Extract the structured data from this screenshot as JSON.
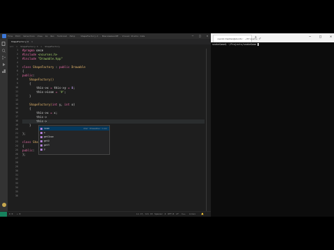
{
  "ide": {
    "title": "ShapeFactory.h - EmacsGamesCPP - Visual Studio Code",
    "menu": [
      "File",
      "Edit",
      "Selection",
      "View",
      "Go",
      "Run",
      "Terminal",
      "Help"
    ],
    "window_controls": [
      "–",
      "□",
      "✕"
    ],
    "tab": {
      "label": "ShapeFactory.h",
      "close": "×"
    },
    "breadcrumb": [
      "src",
      ">",
      "ShapeFactory.h",
      ">",
      "ShapeFactory"
    ],
    "line_numbers": [
      "1",
      "2",
      "3",
      "4",
      "5",
      "6",
      "7",
      "8",
      "9",
      "10",
      "11",
      "12",
      "13",
      "14",
      "15",
      "16",
      "17",
      "18",
      "19",
      "20",
      "21",
      "22",
      "23",
      "24",
      "25",
      "26",
      "27",
      "28",
      "29",
      "30",
      "31",
      "32",
      "33",
      "34",
      "35",
      "36"
    ],
    "code": {
      "l1_kw": "#pragma",
      "l1_rest": " once",
      "l2_kw": "#include",
      "l2_str": " <ncurses.h>",
      "l3_kw": "#include",
      "l3_str": " \"Drawable.hpp\"",
      "l5_kw": "class",
      "l5_ty": " ShapeFactory",
      "l5_op": " : ",
      "l5_kw2": "public",
      "l5_ty2": " Drawable",
      "l6": "{",
      "l7_kw": "public",
      "l7_rest": ":",
      "l8": "    ShapeFactory()",
      "l9": "    {",
      "l10_a": "        this->x",
      "l10_b": " = ",
      "l10_c": "this->y",
      "l10_d": " = ",
      "l10_e": "0",
      "l10_f": ";",
      "l11_a": "        this->icon",
      "l11_b": " = ",
      "l11_c": "'#'",
      "l11_d": ";",
      "l12": "    }",
      "l14_a": "    ShapeFactory(",
      "l14_ty": "int",
      "l14_b": " y, ",
      "l14_ty2": "int",
      "l14_c": " x)",
      "l15": "    {",
      "l16_a": "        this->x",
      "l16_b": " = ",
      "l16_c": "x",
      "l16_d": ";",
      "l17": "        this->",
      "l18": "        this->",
      "l19": "    }",
      "l21": "};",
      "l23_kw": "class",
      "l23_ty": " ShapeFact",
      "l24": "{",
      "l25_kw": "public",
      "l25_rest": ":",
      "l26": "};"
    },
    "suggest": {
      "items": [
        "icon",
        "x",
        "getIcon",
        "getX",
        "getY",
        "y"
      ],
      "selected_detail": "char Drawable::icon"
    },
    "status": {
      "left": [
        "⊗ 0",
        "⚠ 0"
      ],
      "right": [
        "Ln 17, Col 15",
        "Spaces: 4",
        "UTF-8",
        "LF",
        "C++",
        "Linux",
        "🔔"
      ]
    }
  },
  "terminal": {
    "tab_label": "casimirmadden@ubuntu: ~/Projects",
    "tab_close": "×",
    "add": "+",
    "dropdown": "⌄",
    "controls": [
      "–",
      "□",
      "✕"
    ],
    "prompt": "snakeGame$ ~/Projects/snakeGame"
  },
  "colors": {
    "editor_bg": "#1e1e1e",
    "keyword": "#e86ca8",
    "string": "#a5d46a",
    "type": "#e8b86d",
    "number": "#c6a0f6",
    "terminal_bg": "#0c0c0c",
    "status_accent": "#16825d"
  },
  "icons": [
    "vscode-icon",
    "explorer-icon",
    "search-icon",
    "source-control-icon",
    "run-icon",
    "extensions-icon",
    "account-icon",
    "settings-icon",
    "terminal-icon"
  ]
}
